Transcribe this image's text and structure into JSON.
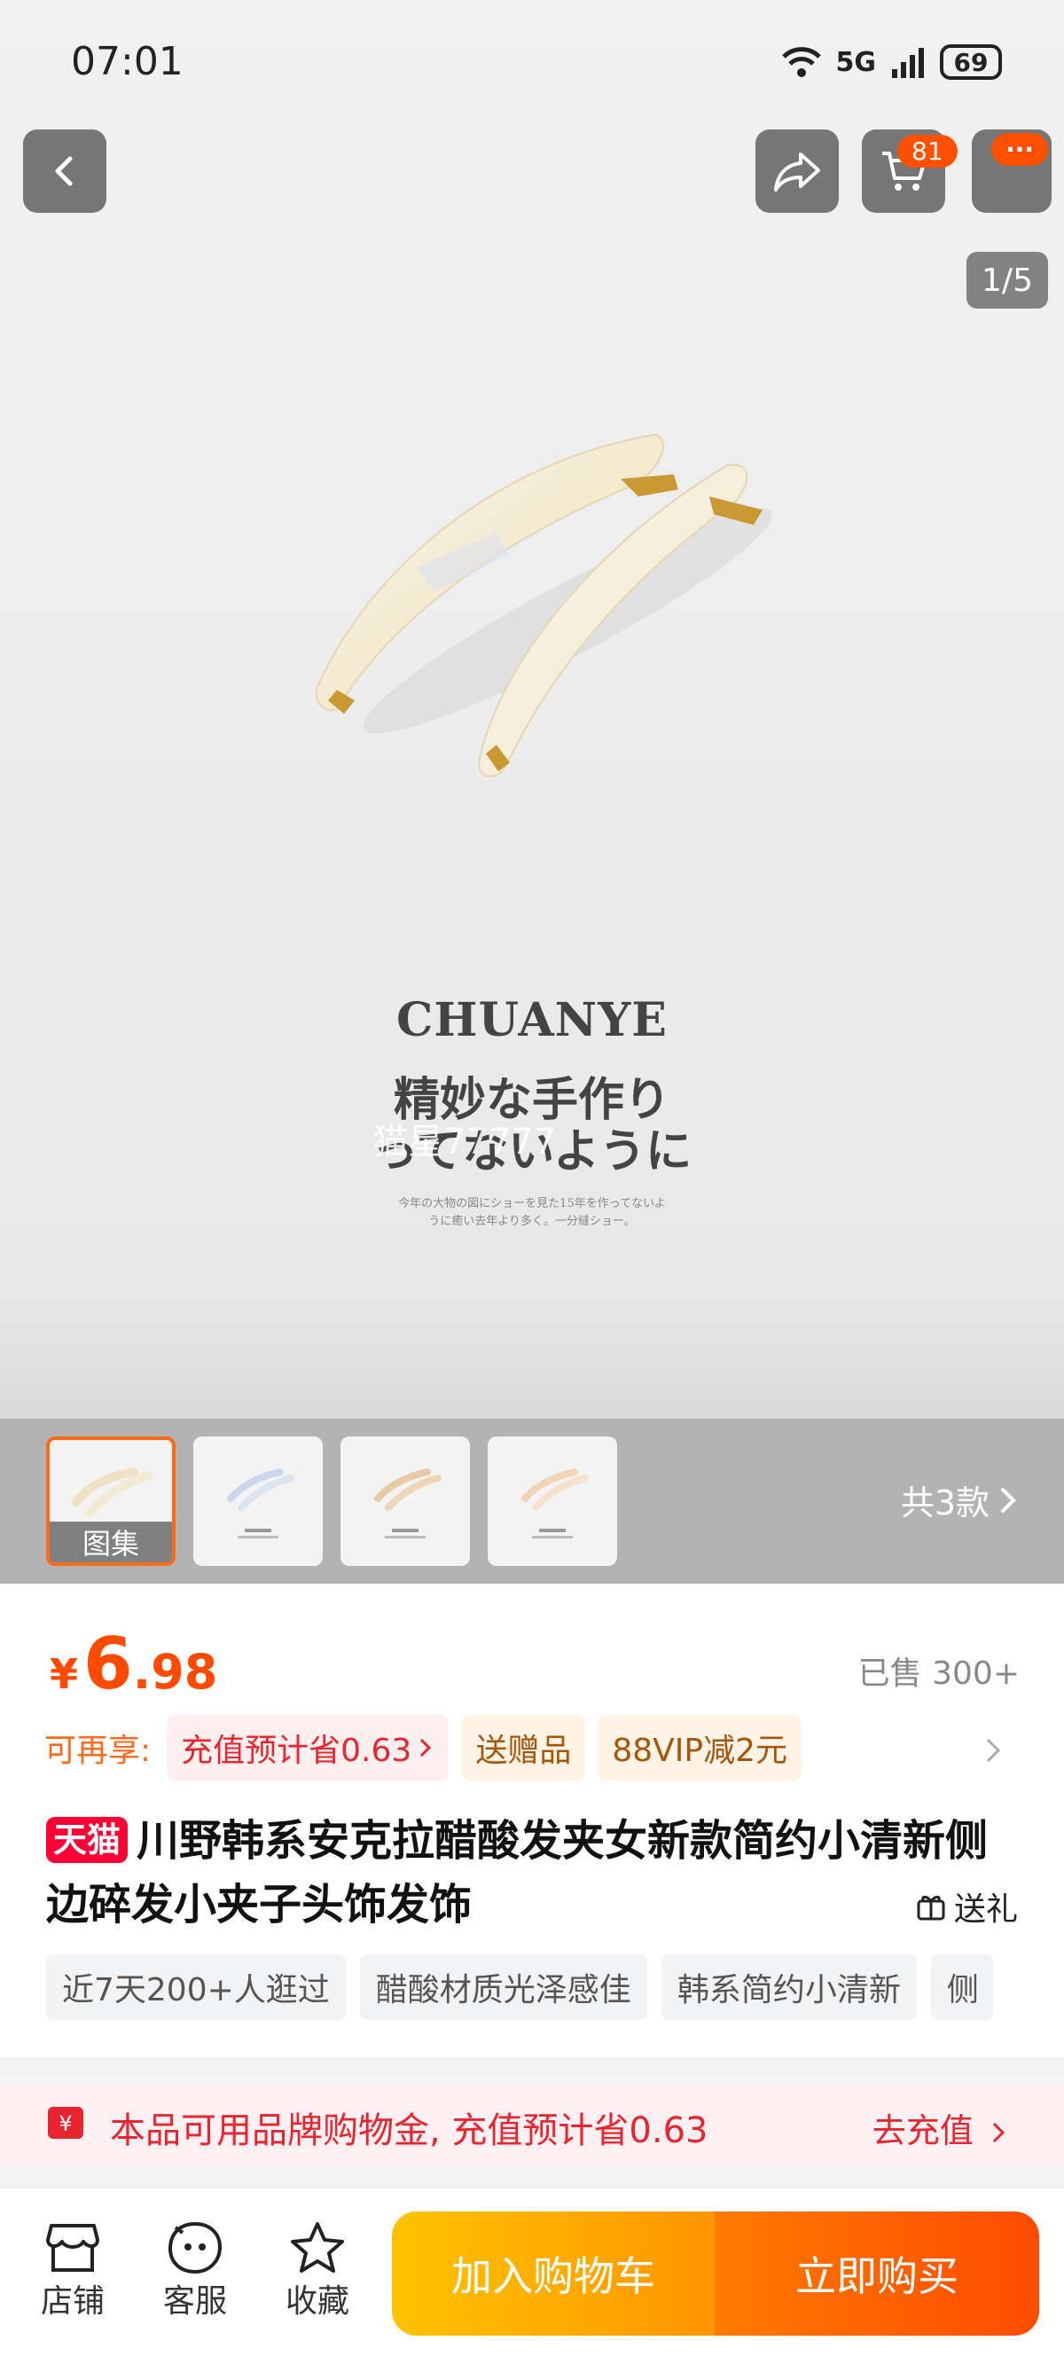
{
  "status_bar": {
    "time": "07:01",
    "network": "5G",
    "battery": "69"
  },
  "top_overlay": {
    "cart_badge": "81",
    "more_badge": "···"
  },
  "gallery": {
    "counter": "1/5",
    "brand": "CHUANYE",
    "line1": "精妙な手作り",
    "line2": "ってないように",
    "small1": "今年の大物の図にショーを見た15年を作ってないよ",
    "small2": "うに癒い去年より多く。一分縫ショー。",
    "watermark": "猫星77777",
    "thumb_label": "图集",
    "variants_label": "共3款"
  },
  "product": {
    "currency": "¥",
    "price_int": "6",
    "price_dec": ".98",
    "sold": "已售 300+",
    "promo_label": "可再享:",
    "promos": [
      "充值预计省0.63",
      "送赠品",
      "88VIP减2元"
    ],
    "tmall_badge": "天猫",
    "title": "川野韩系安克拉醋酸发夹女新款简约小清新侧边碎发小夹子头饰发饰",
    "gift_label": "送礼",
    "tags": [
      "近7天200+人逛过",
      "醋酸材质光泽感佳",
      "韩系简约小清新",
      "侧"
    ]
  },
  "banner": {
    "text": "本品可用品牌购物金, 充值预计省0.63",
    "cta": "去充值"
  },
  "bottom_bar": {
    "shop": "店铺",
    "service": "客服",
    "favorite": "收藏",
    "add_to_cart": "加入购物车",
    "buy_now": "立即购买"
  }
}
